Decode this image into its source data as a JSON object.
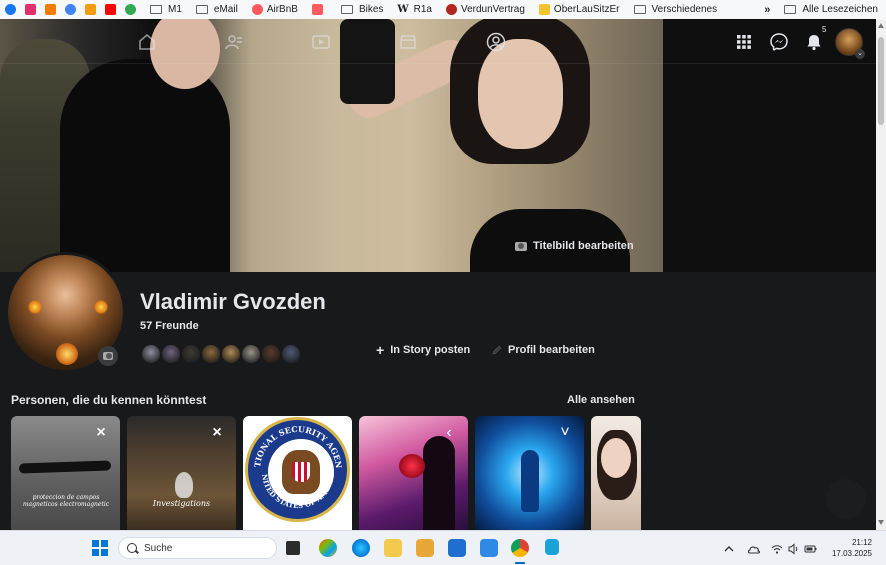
{
  "bookmarks": {
    "items": [
      {
        "label": "",
        "icon": "facebook-icon",
        "color": "#1877f2"
      },
      {
        "label": "",
        "icon": "instagram-icon",
        "color": "#e1306c"
      },
      {
        "label": "",
        "icon": "b-icon",
        "color": "#f57c00"
      },
      {
        "label": "",
        "icon": "google-icon",
        "color": "#4285f4"
      },
      {
        "label": "",
        "icon": "d-icon",
        "color": "#f39c12"
      },
      {
        "label": "",
        "icon": "youtube-icon",
        "color": "#ff0000"
      },
      {
        "label": "",
        "icon": "green-star-icon",
        "color": "#34a853"
      }
    ],
    "named": [
      {
        "label": "M1",
        "icon": "folder-icon"
      },
      {
        "label": "eMail",
        "icon": "folder-icon"
      },
      {
        "label": "AirBnB",
        "icon": "airbnb-icon"
      },
      {
        "label": "",
        "icon": "airbnb-alt-icon"
      },
      {
        "label": "Bikes",
        "icon": "folder-icon"
      },
      {
        "label": "R1a",
        "icon": "wikipedia-icon"
      },
      {
        "label": "VerdunVertrag",
        "icon": "verdun-icon"
      },
      {
        "label": "OberLauSitzEr",
        "icon": "oberlausitz-icon"
      },
      {
        "label": "Verschiedenes",
        "icon": "folder-icon"
      }
    ],
    "more": "»",
    "all_bookmarks": "Alle Lesezeichen"
  },
  "nav": {
    "notification_count": "5",
    "chevron": "⌄"
  },
  "cover": {
    "edit_label": "Titelbild bearbeiten"
  },
  "profile": {
    "name": "Vladimir Gvozden",
    "friends": "57 Freunde",
    "story_button": "In Story posten",
    "edit_button": "Profil bearbeiten",
    "friend_avatar_colors": [
      "#8a8f99",
      "#6e6480",
      "#3d3b36",
      "#8c6a3c",
      "#b08a52",
      "#9a9288",
      "#5a3a2c",
      "#4f5a78"
    ]
  },
  "people": {
    "title": "Personen, die du kennen könntest",
    "see_all": "Alle ansehen",
    "card1_text": "proteccion de campos magneticos electromagnetic",
    "card2_text": "Investigations",
    "card3_top": "NATIONAL SECURITY AGENCY",
    "card3_bottom": "UNITED STATES OF AMERICA"
  },
  "taskbar": {
    "search_placeholder": "Suche",
    "time": "21:12",
    "date": "17.03.2025"
  }
}
